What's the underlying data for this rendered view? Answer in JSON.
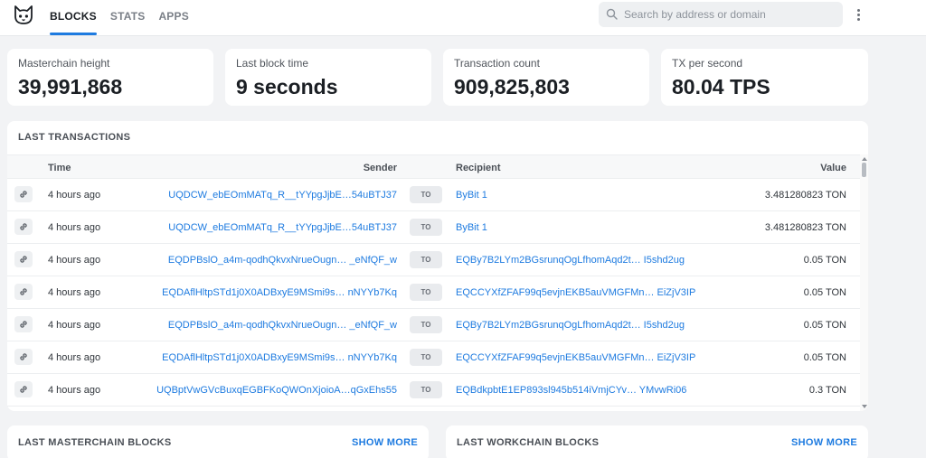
{
  "nav": {
    "tabs": [
      {
        "label": "BLOCKS",
        "active": true
      },
      {
        "label": "STATS",
        "active": false
      },
      {
        "label": "APPS",
        "active": false
      }
    ]
  },
  "search": {
    "placeholder": "Search by address or domain"
  },
  "stats": [
    {
      "label": "Masterchain height",
      "value": "39,991,868"
    },
    {
      "label": "Last block time",
      "value": "9 seconds"
    },
    {
      "label": "Transaction count",
      "value": "909,825,803"
    },
    {
      "label": "TX per second",
      "value": "80.04 TPS"
    }
  ],
  "transactions": {
    "title": "LAST TRANSACTIONS",
    "columns": {
      "time": "Time",
      "sender": "Sender",
      "recipient": "Recipient",
      "value": "Value"
    },
    "to_label": "TO",
    "rows": [
      {
        "time": "4 hours ago",
        "sender": "UQDCW_ebEOmMATq_R__tYYpgJjbE…54uBTJ37",
        "recipient": "ByBit 1",
        "value": "3.481280823 TON"
      },
      {
        "time": "4 hours ago",
        "sender": "UQDCW_ebEOmMATq_R__tYYpgJjbE…54uBTJ37",
        "recipient": "ByBit 1",
        "value": "3.481280823 TON"
      },
      {
        "time": "4 hours ago",
        "sender": "EQDPBslO_a4m-qodhQkvxNrueOugn… _eNfQF_w",
        "recipient": "EQBy7B2LYm2BGsrunqOgLfhomAqd2t… I5shd2ug",
        "value": "0.05 TON"
      },
      {
        "time": "4 hours ago",
        "sender": "EQDAflHltpSTd1j0X0ADBxyE9MSmi9s… nNYYb7Kq",
        "recipient": "EQCCYXfZFAF99q5evjnEKB5auVMGFMn… EiZjV3IP",
        "value": "0.05 TON"
      },
      {
        "time": "4 hours ago",
        "sender": "EQDPBslO_a4m-qodhQkvxNrueOugn… _eNfQF_w",
        "recipient": "EQBy7B2LYm2BGsrunqOgLfhomAqd2t… I5shd2ug",
        "value": "0.05 TON"
      },
      {
        "time": "4 hours ago",
        "sender": "EQDAflHltpSTd1j0X0ADBxyE9MSmi9s… nNYYb7Kq",
        "recipient": "EQCCYXfZFAF99q5evjnEKB5auVMGFMn… EiZjV3IP",
        "value": "0.05 TON"
      },
      {
        "time": "4 hours ago",
        "sender": "UQBptVwGVcBuxqEGBFKoQWOnXjoioA…qGxEhs55",
        "recipient": "EQBdkpbtE1EP893sl945b514iVmjCYv… YMvwRi06",
        "value": "0.3 TON"
      }
    ]
  },
  "masterchain": {
    "title": "LAST MASTERCHAIN BLOCKS",
    "show_more": "SHOW MORE"
  },
  "workchain": {
    "title": "LAST WORKCHAIN BLOCKS",
    "show_more": "SHOW MORE"
  },
  "icons": {
    "logo": "cat-logo-icon",
    "search": "search-icon",
    "more": "more-vertical-icon",
    "row": "link-icon"
  },
  "colors": {
    "accent": "#1e7be0",
    "background": "#f2f3f5",
    "card": "#ffffff"
  }
}
